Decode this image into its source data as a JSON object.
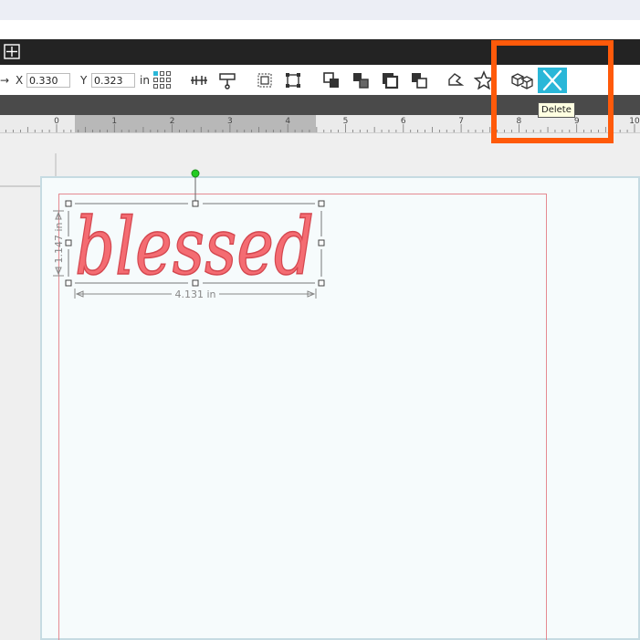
{
  "toolbar": {
    "x_label": "X",
    "x_value": "0.330",
    "y_label": "Y",
    "y_value": "0.323",
    "unit": "in"
  },
  "ruler": {
    "labels": [
      "0",
      "1",
      "2",
      "3",
      "4",
      "5",
      "6",
      "7",
      "8",
      "9",
      "10"
    ]
  },
  "tooltip": {
    "text": "Delete"
  },
  "selection": {
    "width_label": "4.131 in",
    "height_label": "1.147 in"
  },
  "design": {
    "text": "blessed"
  },
  "colors": {
    "accent": "#2ab7d8",
    "highlight": "#ff5a0a",
    "design_fill": "#f46c72",
    "rotate_handle": "#22cc22"
  },
  "icons": [
    "move-icon",
    "width-height-lock-icon",
    "align-icon",
    "group-icon",
    "ungroup-icon",
    "bring-to-front-icon",
    "bring-forward-icon",
    "send-backward-icon",
    "send-to-back-icon",
    "weld-icon",
    "favorite-icon",
    "3d-box-icon",
    "delete-icon"
  ]
}
